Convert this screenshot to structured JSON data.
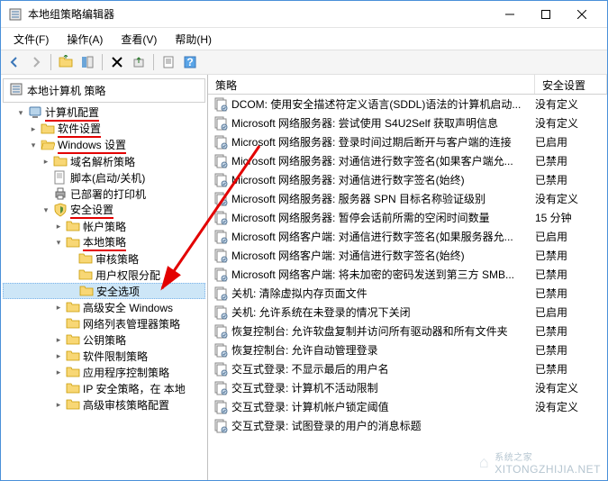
{
  "window": {
    "title": "本地组策略编辑器"
  },
  "menubar": {
    "file": "文件(F)",
    "action": "操作(A)",
    "view": "查看(V)",
    "help": "帮助(H)"
  },
  "tree": {
    "root": "本地计算机 策略",
    "nodes": [
      {
        "label": "计算机配置",
        "depth": 1,
        "expander": "▾",
        "icon": "computer",
        "underline": true
      },
      {
        "label": "软件设置",
        "depth": 2,
        "expander": "▸",
        "icon": "folder",
        "underline": true
      },
      {
        "label": "Windows 设置",
        "depth": 2,
        "expander": "▾",
        "icon": "folder-open",
        "underline": true
      },
      {
        "label": "域名解析策略",
        "depth": 3,
        "expander": "▸",
        "icon": "folder"
      },
      {
        "label": "脚本(启动/关机)",
        "depth": 3,
        "expander": "",
        "icon": "script"
      },
      {
        "label": "已部署的打印机",
        "depth": 3,
        "expander": "",
        "icon": "printer"
      },
      {
        "label": "安全设置",
        "depth": 3,
        "expander": "▾",
        "icon": "shield",
        "underline": true
      },
      {
        "label": "帐户策略",
        "depth": 4,
        "expander": "▸",
        "icon": "folder"
      },
      {
        "label": "本地策略",
        "depth": 4,
        "expander": "▾",
        "icon": "folder",
        "underline": true
      },
      {
        "label": "审核策略",
        "depth": 5,
        "expander": "",
        "icon": "folder"
      },
      {
        "label": "用户权限分配",
        "depth": 5,
        "expander": "",
        "icon": "folder"
      },
      {
        "label": "安全选项",
        "depth": 5,
        "expander": "",
        "icon": "folder",
        "selected": true
      },
      {
        "label": "高级安全 Windows",
        "depth": 4,
        "expander": "▸",
        "icon": "folder"
      },
      {
        "label": "网络列表管理器策略",
        "depth": 4,
        "expander": "",
        "icon": "folder"
      },
      {
        "label": "公钥策略",
        "depth": 4,
        "expander": "▸",
        "icon": "folder"
      },
      {
        "label": "软件限制策略",
        "depth": 4,
        "expander": "▸",
        "icon": "folder"
      },
      {
        "label": "应用程序控制策略",
        "depth": 4,
        "expander": "▸",
        "icon": "folder"
      },
      {
        "label": "IP 安全策略，在 本地",
        "depth": 4,
        "expander": "",
        "icon": "folder"
      },
      {
        "label": "高级审核策略配置",
        "depth": 4,
        "expander": "▸",
        "icon": "folder"
      }
    ]
  },
  "list": {
    "col_policy": "策略",
    "col_setting": "安全设置",
    "rows": [
      {
        "name": "DCOM: 使用安全描述符定义语言(SDDL)语法的计算机启动...",
        "value": "没有定义"
      },
      {
        "name": "Microsoft 网络服务器: 尝试使用 S4U2Self 获取声明信息",
        "value": "没有定义"
      },
      {
        "name": "Microsoft 网络服务器: 登录时间过期后断开与客户端的连接",
        "value": "已启用"
      },
      {
        "name": "Microsoft 网络服务器: 对通信进行数字签名(如果客户端允...",
        "value": "已禁用"
      },
      {
        "name": "Microsoft 网络服务器: 对通信进行数字签名(始终)",
        "value": "已禁用"
      },
      {
        "name": "Microsoft 网络服务器: 服务器 SPN 目标名称验证级别",
        "value": "没有定义"
      },
      {
        "name": "Microsoft 网络服务器: 暂停会话前所需的空闲时间数量",
        "value": "15 分钟"
      },
      {
        "name": "Microsoft 网络客户端: 对通信进行数字签名(如果服务器允...",
        "value": "已启用"
      },
      {
        "name": "Microsoft 网络客户端: 对通信进行数字签名(始终)",
        "value": "已禁用"
      },
      {
        "name": "Microsoft 网络客户端: 将未加密的密码发送到第三方 SMB...",
        "value": "已禁用"
      },
      {
        "name": "关机: 清除虚拟内存页面文件",
        "value": "已禁用"
      },
      {
        "name": "关机: 允许系统在未登录的情况下关闭",
        "value": "已启用"
      },
      {
        "name": "恢复控制台: 允许软盘复制并访问所有驱动器和所有文件夹",
        "value": "已禁用"
      },
      {
        "name": "恢复控制台: 允许自动管理登录",
        "value": "已禁用"
      },
      {
        "name": "交互式登录: 不显示最后的用户名",
        "value": "已禁用"
      },
      {
        "name": "交互式登录: 计算机不活动限制",
        "value": "没有定义"
      },
      {
        "name": "交互式登录: 计算机帐户锁定阈值",
        "value": "没有定义"
      },
      {
        "name": "交互式登录: 试图登录的用户的消息标题",
        "value": ""
      }
    ]
  },
  "watermark": {
    "text": "XITONGZHIJIA.NET",
    "brand": "系统之家"
  }
}
